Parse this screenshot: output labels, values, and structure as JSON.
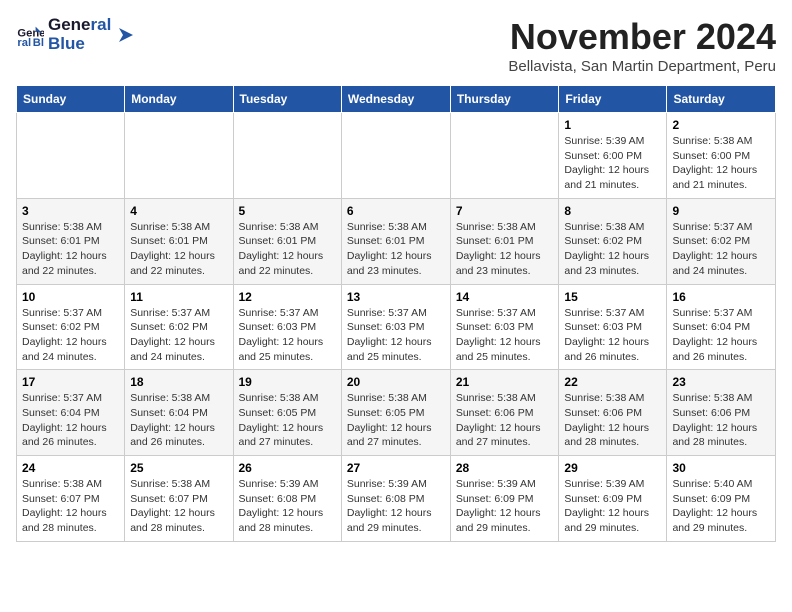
{
  "header": {
    "logo_line1": "General",
    "logo_line2": "Blue",
    "month_year": "November 2024",
    "location": "Bellavista, San Martin Department, Peru"
  },
  "weekdays": [
    "Sunday",
    "Monday",
    "Tuesday",
    "Wednesday",
    "Thursday",
    "Friday",
    "Saturday"
  ],
  "weeks": [
    [
      {
        "day": "",
        "info": ""
      },
      {
        "day": "",
        "info": ""
      },
      {
        "day": "",
        "info": ""
      },
      {
        "day": "",
        "info": ""
      },
      {
        "day": "",
        "info": ""
      },
      {
        "day": "1",
        "info": "Sunrise: 5:39 AM\nSunset: 6:00 PM\nDaylight: 12 hours and 21 minutes."
      },
      {
        "day": "2",
        "info": "Sunrise: 5:38 AM\nSunset: 6:00 PM\nDaylight: 12 hours and 21 minutes."
      }
    ],
    [
      {
        "day": "3",
        "info": "Sunrise: 5:38 AM\nSunset: 6:01 PM\nDaylight: 12 hours and 22 minutes."
      },
      {
        "day": "4",
        "info": "Sunrise: 5:38 AM\nSunset: 6:01 PM\nDaylight: 12 hours and 22 minutes."
      },
      {
        "day": "5",
        "info": "Sunrise: 5:38 AM\nSunset: 6:01 PM\nDaylight: 12 hours and 22 minutes."
      },
      {
        "day": "6",
        "info": "Sunrise: 5:38 AM\nSunset: 6:01 PM\nDaylight: 12 hours and 23 minutes."
      },
      {
        "day": "7",
        "info": "Sunrise: 5:38 AM\nSunset: 6:01 PM\nDaylight: 12 hours and 23 minutes."
      },
      {
        "day": "8",
        "info": "Sunrise: 5:38 AM\nSunset: 6:02 PM\nDaylight: 12 hours and 23 minutes."
      },
      {
        "day": "9",
        "info": "Sunrise: 5:37 AM\nSunset: 6:02 PM\nDaylight: 12 hours and 24 minutes."
      }
    ],
    [
      {
        "day": "10",
        "info": "Sunrise: 5:37 AM\nSunset: 6:02 PM\nDaylight: 12 hours and 24 minutes."
      },
      {
        "day": "11",
        "info": "Sunrise: 5:37 AM\nSunset: 6:02 PM\nDaylight: 12 hours and 24 minutes."
      },
      {
        "day": "12",
        "info": "Sunrise: 5:37 AM\nSunset: 6:03 PM\nDaylight: 12 hours and 25 minutes."
      },
      {
        "day": "13",
        "info": "Sunrise: 5:37 AM\nSunset: 6:03 PM\nDaylight: 12 hours and 25 minutes."
      },
      {
        "day": "14",
        "info": "Sunrise: 5:37 AM\nSunset: 6:03 PM\nDaylight: 12 hours and 25 minutes."
      },
      {
        "day": "15",
        "info": "Sunrise: 5:37 AM\nSunset: 6:03 PM\nDaylight: 12 hours and 26 minutes."
      },
      {
        "day": "16",
        "info": "Sunrise: 5:37 AM\nSunset: 6:04 PM\nDaylight: 12 hours and 26 minutes."
      }
    ],
    [
      {
        "day": "17",
        "info": "Sunrise: 5:37 AM\nSunset: 6:04 PM\nDaylight: 12 hours and 26 minutes."
      },
      {
        "day": "18",
        "info": "Sunrise: 5:38 AM\nSunset: 6:04 PM\nDaylight: 12 hours and 26 minutes."
      },
      {
        "day": "19",
        "info": "Sunrise: 5:38 AM\nSunset: 6:05 PM\nDaylight: 12 hours and 27 minutes."
      },
      {
        "day": "20",
        "info": "Sunrise: 5:38 AM\nSunset: 6:05 PM\nDaylight: 12 hours and 27 minutes."
      },
      {
        "day": "21",
        "info": "Sunrise: 5:38 AM\nSunset: 6:06 PM\nDaylight: 12 hours and 27 minutes."
      },
      {
        "day": "22",
        "info": "Sunrise: 5:38 AM\nSunset: 6:06 PM\nDaylight: 12 hours and 28 minutes."
      },
      {
        "day": "23",
        "info": "Sunrise: 5:38 AM\nSunset: 6:06 PM\nDaylight: 12 hours and 28 minutes."
      }
    ],
    [
      {
        "day": "24",
        "info": "Sunrise: 5:38 AM\nSunset: 6:07 PM\nDaylight: 12 hours and 28 minutes."
      },
      {
        "day": "25",
        "info": "Sunrise: 5:38 AM\nSunset: 6:07 PM\nDaylight: 12 hours and 28 minutes."
      },
      {
        "day": "26",
        "info": "Sunrise: 5:39 AM\nSunset: 6:08 PM\nDaylight: 12 hours and 28 minutes."
      },
      {
        "day": "27",
        "info": "Sunrise: 5:39 AM\nSunset: 6:08 PM\nDaylight: 12 hours and 29 minutes."
      },
      {
        "day": "28",
        "info": "Sunrise: 5:39 AM\nSunset: 6:09 PM\nDaylight: 12 hours and 29 minutes."
      },
      {
        "day": "29",
        "info": "Sunrise: 5:39 AM\nSunset: 6:09 PM\nDaylight: 12 hours and 29 minutes."
      },
      {
        "day": "30",
        "info": "Sunrise: 5:40 AM\nSunset: 6:09 PM\nDaylight: 12 hours and 29 minutes."
      }
    ]
  ]
}
